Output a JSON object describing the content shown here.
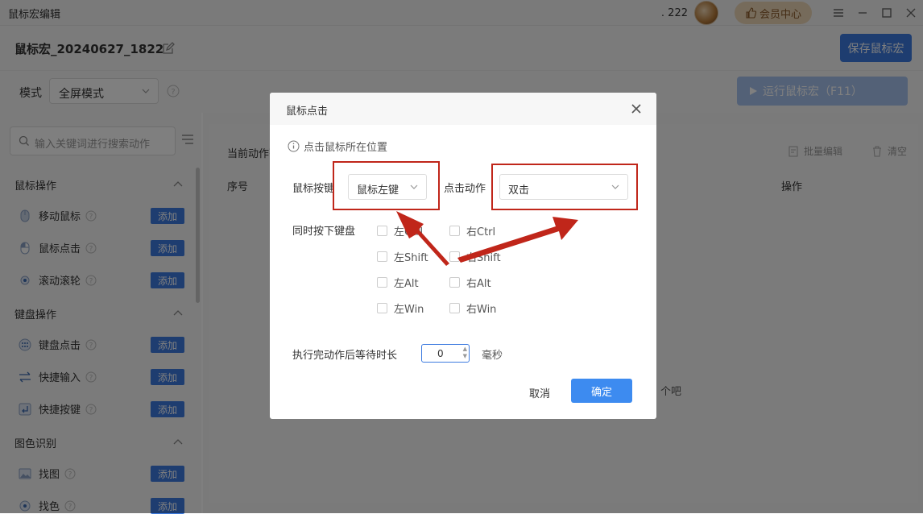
{
  "app": {
    "title": "鼠标宏编辑",
    "user_name": ". 222",
    "member_label": "会员中心"
  },
  "header": {
    "macro_name": "鼠标宏_20240627_1822",
    "save_label": "保存鼠标宏"
  },
  "mode": {
    "label": "模式",
    "value": "全屏模式",
    "run_label": "运行鼠标宏（F11）"
  },
  "sidebar": {
    "search_placeholder": "输入关键词进行搜索动作",
    "add_label": "添加",
    "categories": [
      {
        "label": "鼠标操作",
        "items": [
          "移动鼠标",
          "鼠标点击",
          "滚动滚轮"
        ]
      },
      {
        "label": "键盘操作",
        "items": [
          "键盘点击",
          "快捷输入",
          "快捷按键"
        ]
      },
      {
        "label": "图色识别",
        "items": [
          "找图",
          "找色"
        ]
      }
    ]
  },
  "main": {
    "current_label": "当前动作列表",
    "batch_edit": "批量编辑",
    "clear": "清空",
    "col_no": "序号",
    "col_op": "操作",
    "empty_tail": "个吧"
  },
  "dialog": {
    "title": "鼠标点击",
    "info": "点击鼠标所在位置",
    "button_label": "鼠标按键",
    "button_value": "鼠标左键",
    "action_label": "点击动作",
    "action_value": "双击",
    "keys_label": "同时按下键盘",
    "keys": [
      "左Ctrl",
      "右Ctrl",
      "左Shift",
      "右Shift",
      "左Alt",
      "右Alt",
      "左Win",
      "右Win"
    ],
    "wait_label": "执行完动作后等待时长",
    "wait_value": "0",
    "wait_unit": "毫秒",
    "cancel_label": "取消",
    "ok_label": "确定"
  },
  "colors": {
    "accent": "#3d7be0",
    "annotation": "#c0261a",
    "member": "#ecd6b6"
  }
}
